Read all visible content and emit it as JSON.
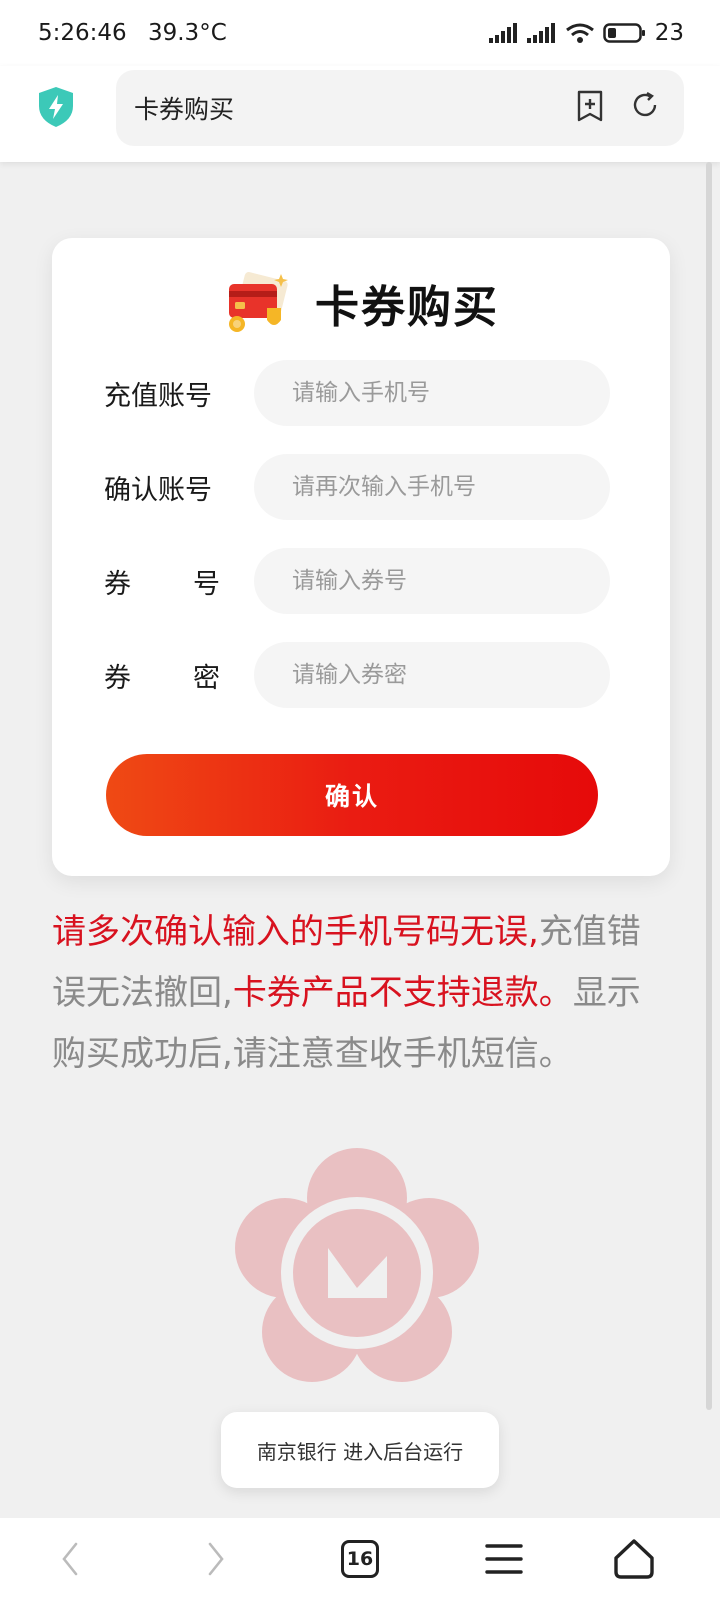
{
  "status_bar": {
    "time": "5:26:46",
    "temperature": "39.3°C",
    "battery": "23"
  },
  "browser": {
    "url_title": "卡券购买",
    "shield_color": "#3cc9b8",
    "tab_count": "16"
  },
  "card": {
    "title": "卡券购买",
    "fields": [
      {
        "label_chars": [
          "充值账号"
        ],
        "placeholder": "请输入手机号"
      },
      {
        "label_chars": [
          "确认账号"
        ],
        "placeholder": "请再次输入手机号"
      },
      {
        "label_chars": [
          "券",
          "号"
        ],
        "placeholder": "请输入券号"
      },
      {
        "label_chars": [
          "券",
          "密"
        ],
        "placeholder": "请输入券密"
      }
    ],
    "confirm_label": "确认"
  },
  "notice": {
    "part1_red": "请多次确认输入的手机号码无误,",
    "part2_gray": "充值错误无法撤回,",
    "part3_red": "卡券产品不支持退款。",
    "part4_gray": "显示购买成功后,请注意查收手机短信。"
  },
  "toast": {
    "text": "南京银行 进入后台运行"
  },
  "colors": {
    "accent_red": "#d8121f",
    "button_gradient_start": "#ef4a14",
    "button_gradient_end": "#e60a0a",
    "watermark": "#e7b0b3"
  }
}
